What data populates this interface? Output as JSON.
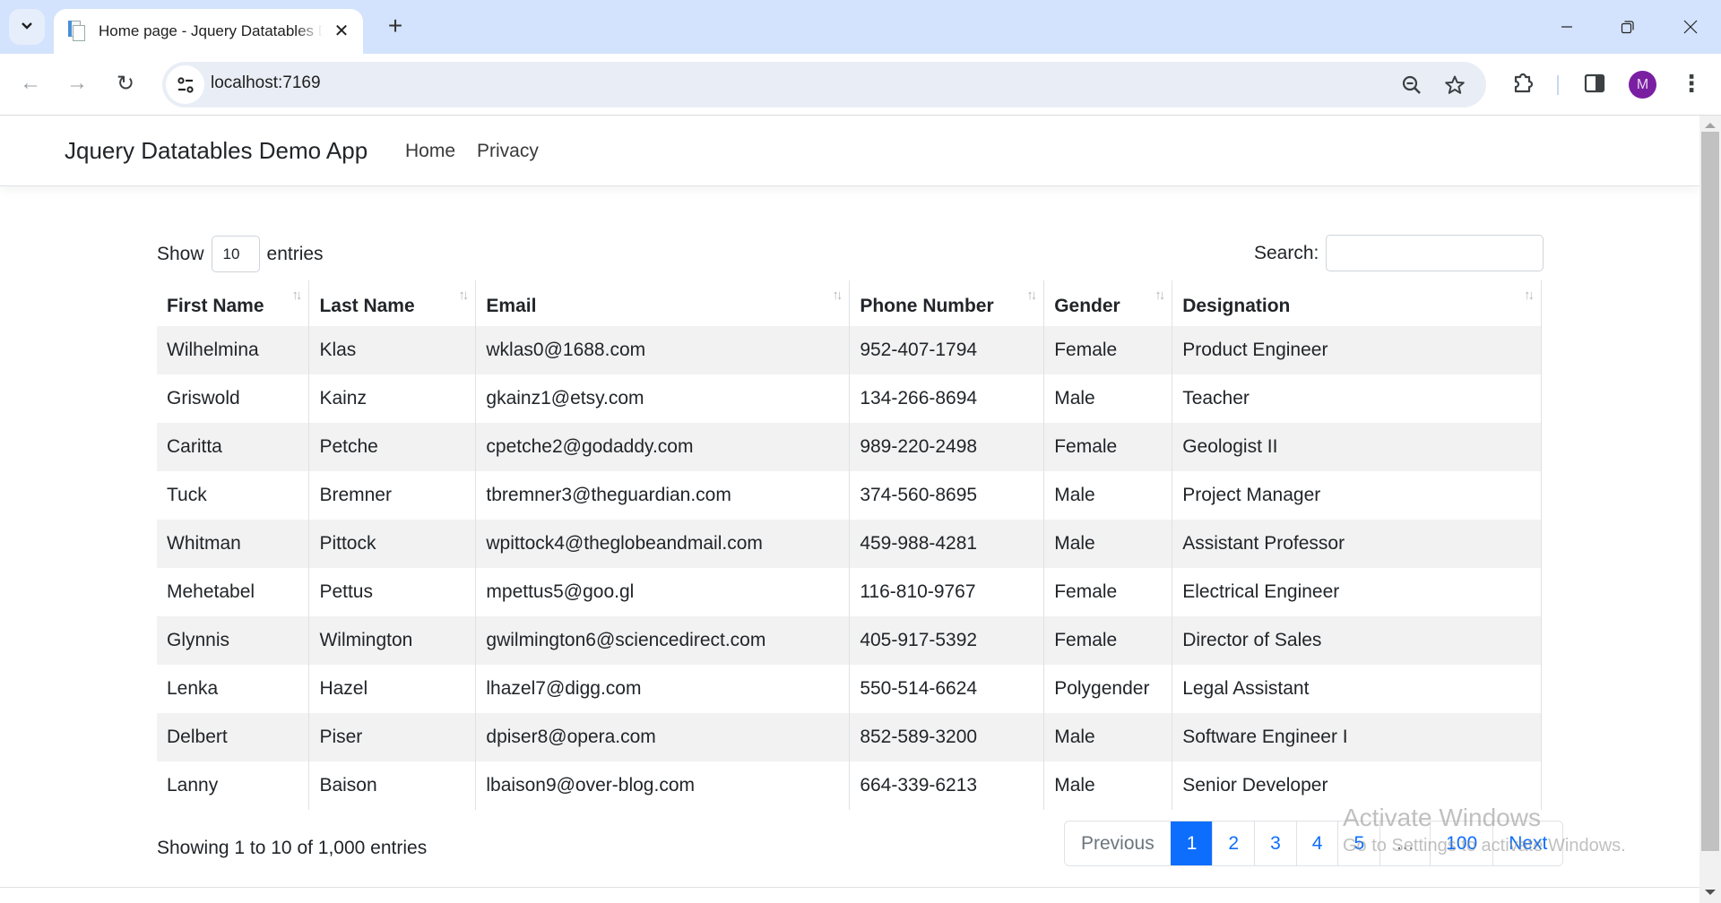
{
  "browser": {
    "tab_title": "Home page - Jquery Datatables Demo App",
    "url": "localhost:7169",
    "avatar_initial": "M",
    "icons": {
      "tab_search": "chevron-down-icon",
      "tab_close": "close-icon",
      "new_tab": "plus-icon",
      "back": "arrow-left-icon",
      "forward": "arrow-right-icon",
      "reload": "reload-icon",
      "site_info": "tune-icon",
      "zoom": "zoom-out-icon",
      "bookmark": "star-icon",
      "extensions": "puzzle-icon",
      "side_panel": "side-panel-icon",
      "menu": "kebab-menu-icon"
    },
    "glyphs": {
      "tab_close": "✕",
      "new_tab": "+",
      "back": "←",
      "forward": "→",
      "reload": "↻",
      "menu": "⋮"
    }
  },
  "navbar": {
    "brand": "Jquery Datatables Demo App",
    "links": [
      {
        "label": "Home"
      },
      {
        "label": "Privacy"
      }
    ]
  },
  "datatable": {
    "length": {
      "prefix": "Show",
      "value": "10",
      "suffix": "entries"
    },
    "search": {
      "label": "Search:",
      "value": "",
      "placeholder": ""
    },
    "sort_glyph": "↑↓",
    "columns": [
      "First Name",
      "Last Name",
      "Email",
      "Phone Number",
      "Gender",
      "Designation"
    ],
    "rows": [
      [
        "Wilhelmina",
        "Klas",
        "wklas0@1688.com",
        "952-407-1794",
        "Female",
        "Product Engineer"
      ],
      [
        "Griswold",
        "Kainz",
        "gkainz1@etsy.com",
        "134-266-8694",
        "Male",
        "Teacher"
      ],
      [
        "Caritta",
        "Petche",
        "cpetche2@godaddy.com",
        "989-220-2498",
        "Female",
        "Geologist II"
      ],
      [
        "Tuck",
        "Bremner",
        "tbremner3@theguardian.com",
        "374-560-8695",
        "Male",
        "Project Manager"
      ],
      [
        "Whitman",
        "Pittock",
        "wpittock4@theglobeandmail.com",
        "459-988-4281",
        "Male",
        "Assistant Professor"
      ],
      [
        "Mehetabel",
        "Pettus",
        "mpettus5@goo.gl",
        "116-810-9767",
        "Female",
        "Electrical Engineer"
      ],
      [
        "Glynnis",
        "Wilmington",
        "gwilmington6@sciencedirect.com",
        "405-917-5392",
        "Female",
        "Director of Sales"
      ],
      [
        "Lenka",
        "Hazel",
        "lhazel7@digg.com",
        "550-514-6624",
        "Polygender",
        "Legal Assistant"
      ],
      [
        "Delbert",
        "Piser",
        "dpiser8@opera.com",
        "852-589-3200",
        "Male",
        "Software Engineer I"
      ],
      [
        "Lanny",
        "Baison",
        "lbaison9@over-blog.com",
        "664-339-6213",
        "Male",
        "Senior Developer"
      ]
    ],
    "info": "Showing 1 to 10 of 1,000 entries",
    "pagination": {
      "previous": "Previous",
      "pages": [
        "1",
        "2",
        "3",
        "4",
        "5",
        "…",
        "100"
      ],
      "active_page": "1",
      "next": "Next"
    }
  },
  "watermark": {
    "title": "Activate Windows",
    "subtitle": "Go to Settings to activate Windows."
  },
  "colors": {
    "accent": "#0d6efd",
    "tabbar_bg": "#d3e3fd",
    "avatar_bg": "#7b1fa2",
    "striped_row": "#f2f2f2"
  }
}
